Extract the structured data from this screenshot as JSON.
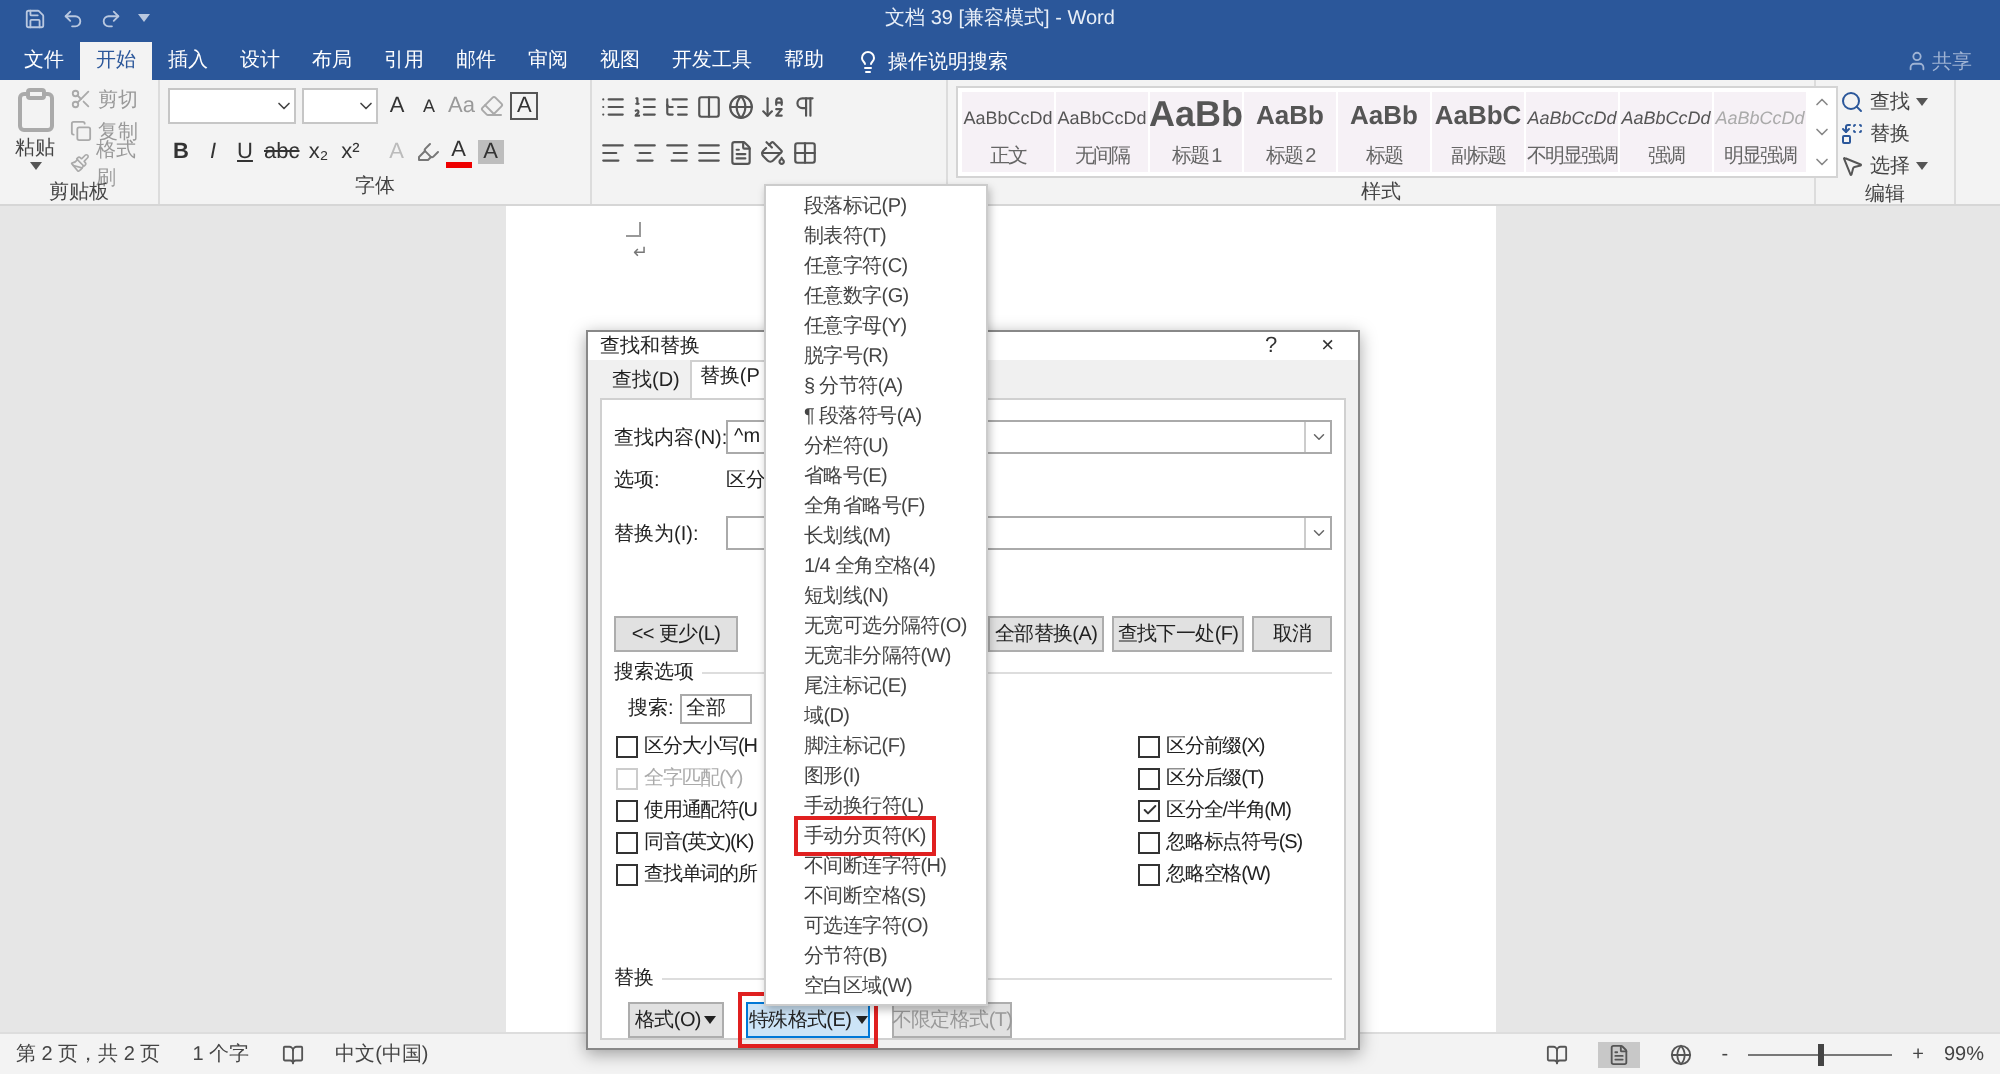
{
  "title_bar": {
    "title": "文档 39 [兼容模式] - Word",
    "share": "共享"
  },
  "ribbon_tabs": [
    {
      "label": "文件",
      "selected": false
    },
    {
      "label": "开始",
      "selected": true
    },
    {
      "label": "插入",
      "selected": false
    },
    {
      "label": "设计",
      "selected": false
    },
    {
      "label": "布局",
      "selected": false
    },
    {
      "label": "引用",
      "selected": false
    },
    {
      "label": "邮件",
      "selected": false
    },
    {
      "label": "审阅",
      "selected": false
    },
    {
      "label": "视图",
      "selected": false
    },
    {
      "label": "开发工具",
      "selected": false
    },
    {
      "label": "帮助",
      "selected": false
    }
  ],
  "tell_me": "操作说明搜索",
  "clipboard": {
    "paste": "粘贴",
    "label": "剪贴板",
    "tools": [
      {
        "label": "剪切",
        "kind": "cut"
      },
      {
        "label": "复制",
        "kind": "copy"
      },
      {
        "label": "格式刷",
        "kind": "painter"
      }
    ]
  },
  "font": {
    "label": "字体",
    "border_button": "A",
    "size_buttons": [
      {
        "text": "A",
        "kind": "grow"
      },
      {
        "text": "A",
        "kind": "shrink"
      },
      {
        "text": "Aa",
        "kind": "case"
      }
    ],
    "format_buttons": [
      {
        "text": "B",
        "kind": "bold"
      },
      {
        "text": "I",
        "kind": "italic"
      },
      {
        "text": "U",
        "kind": "underline"
      },
      {
        "text": "abc",
        "kind": "strike"
      },
      {
        "text": "x₂",
        "kind": "sub"
      },
      {
        "text": "x²",
        "kind": "sup"
      }
    ],
    "effect_buttons": [
      {
        "text": "A",
        "kind": "effects"
      },
      {
        "text": "A",
        "kind": "color"
      },
      {
        "text": "A",
        "kind": "shade"
      }
    ]
  },
  "styles": {
    "label": "样式",
    "items": [
      {
        "preview": "AaBbCcDd",
        "name": "正文",
        "kind": "body"
      },
      {
        "preview": "AaBbCcDd",
        "name": "无间隔",
        "kind": "body"
      },
      {
        "preview": "AaBb",
        "name": "标题 1",
        "kind": "big"
      },
      {
        "preview": "AaBb",
        "name": "标题 2",
        "kind": "heading"
      },
      {
        "preview": "AaBb",
        "name": "标题",
        "kind": "heading"
      },
      {
        "preview": "AaBbC",
        "name": "副标题",
        "kind": "heading"
      },
      {
        "preview": "AaBbCcDd",
        "name": "不明显强调",
        "kind": "italic"
      },
      {
        "preview": "AaBbCcDd",
        "name": "强调",
        "kind": "italic"
      },
      {
        "preview": "AaBbCcDd",
        "name": "明显强调",
        "kind": "faint"
      }
    ]
  },
  "editing": {
    "label": "编辑",
    "items": [
      {
        "label": "查找",
        "kind": "find",
        "dropdown": true
      },
      {
        "label": "替换",
        "kind": "replace",
        "dropdown": false
      },
      {
        "label": "选择",
        "kind": "select",
        "dropdown": true
      }
    ]
  },
  "document": {
    "paragraph_mark": "↵"
  },
  "dialog": {
    "title": "查找和替换",
    "help": "?",
    "close": "×",
    "tabs": [
      {
        "label": "查找(D)",
        "selected": false
      },
      {
        "label": "替换(P",
        "selected": true
      }
    ],
    "find_label": "查找内容(N):",
    "find_value": "^m",
    "options_label": "选项:",
    "options_value": "区分",
    "replace_label": "替换为(I):",
    "less_button": "<< 更少(L)",
    "action_buttons": [
      "全部替换(A)",
      "查找下一处(F)",
      "取消"
    ],
    "search_options_label": "搜索选项",
    "search_label": "搜索:",
    "search_value": "全部",
    "left_options": [
      {
        "label": "区分大小写(H",
        "checked": false,
        "disabled": false
      },
      {
        "label": "全字匹配(Y)",
        "checked": false,
        "disabled": true
      },
      {
        "label": "使用通配符(U",
        "checked": false,
        "disabled": false
      },
      {
        "label": "同音(英文)(K)",
        "checked": false,
        "disabled": false
      },
      {
        "label": "查找单词的所",
        "checked": false,
        "disabled": false
      }
    ],
    "right_options": [
      {
        "label": "区分前缀(X)",
        "checked": false,
        "disabled": false
      },
      {
        "label": "区分后缀(T)",
        "checked": false,
        "disabled": false
      },
      {
        "label": "区分全/半角(M)",
        "checked": true,
        "disabled": false
      },
      {
        "label": "忽略标点符号(S)",
        "checked": false,
        "disabled": false
      },
      {
        "label": "忽略空格(W)",
        "checked": false,
        "disabled": false
      }
    ],
    "replace_section_label": "替换",
    "bottom_buttons": [
      {
        "label": "格式(O)",
        "dropdown": true,
        "disabled": false,
        "active": false,
        "highlighted": false
      },
      {
        "label": "特殊格式(E)",
        "dropdown": true,
        "disabled": false,
        "active": true,
        "highlighted": true
      },
      {
        "label": "不限定格式(T)",
        "dropdown": false,
        "disabled": true,
        "active": false,
        "highlighted": false
      }
    ]
  },
  "special_menu": {
    "items": [
      {
        "label": "段落标记(P)",
        "highlighted": false
      },
      {
        "label": "制表符(T)",
        "highlighted": false
      },
      {
        "label": "任意字符(C)",
        "highlighted": false
      },
      {
        "label": "任意数字(G)",
        "highlighted": false
      },
      {
        "label": "任意字母(Y)",
        "highlighted": false
      },
      {
        "label": "脱字号(R)",
        "highlighted": false
      },
      {
        "label": "§ 分节符(A)",
        "highlighted": false
      },
      {
        "label": "¶ 段落符号(A)",
        "highlighted": false
      },
      {
        "label": "分栏符(U)",
        "highlighted": false
      },
      {
        "label": "省略号(E)",
        "highlighted": false
      },
      {
        "label": "全角省略号(F)",
        "highlighted": false
      },
      {
        "label": "长划线(M)",
        "highlighted": false
      },
      {
        "label": "1/4 全角空格(4)",
        "highlighted": false
      },
      {
        "label": "短划线(N)",
        "highlighted": false
      },
      {
        "label": "无宽可选分隔符(O)",
        "highlighted": false
      },
      {
        "label": "无宽非分隔符(W)",
        "highlighted": false
      },
      {
        "label": "尾注标记(E)",
        "highlighted": false
      },
      {
        "label": "域(D)",
        "highlighted": false
      },
      {
        "label": "脚注标记(F)",
        "highlighted": false
      },
      {
        "label": "图形(I)",
        "highlighted": false
      },
      {
        "label": "手动换行符(L)",
        "highlighted": false
      },
      {
        "label": "手动分页符(K)",
        "highlighted": true
      },
      {
        "label": "不间断连字符(H)",
        "highlighted": false
      },
      {
        "label": "不间断空格(S)",
        "highlighted": false
      },
      {
        "label": "可选连字符(O)",
        "highlighted": false
      },
      {
        "label": "分节符(B)",
        "highlighted": false
      },
      {
        "label": "空白区域(W)",
        "highlighted": false
      }
    ]
  },
  "status_bar": {
    "page": "第 2 页，共 2 页",
    "words": "1 个字",
    "language": "中文(中国)",
    "zoom_out": "-",
    "zoom": {
      "level": 0.5
    },
    "zoom_in": "+",
    "zoom_value": "99%"
  }
}
